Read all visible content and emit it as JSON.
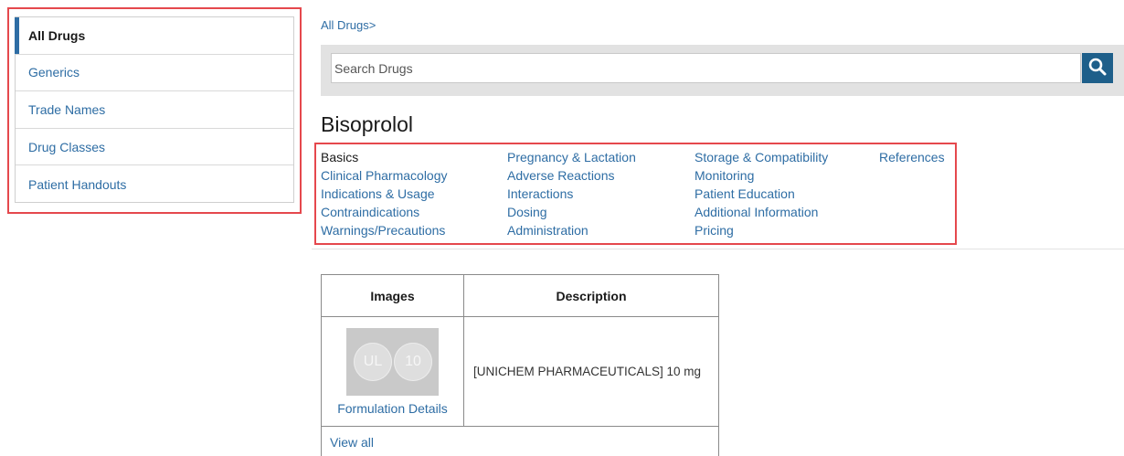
{
  "sidebar": {
    "items": [
      {
        "label": "All Drugs",
        "active": true
      },
      {
        "label": "Generics"
      },
      {
        "label": "Trade Names"
      },
      {
        "label": "Drug Classes"
      },
      {
        "label": "Patient Handouts"
      }
    ]
  },
  "breadcrumb": "All Drugs>",
  "search": {
    "placeholder": "Search Drugs",
    "icon": "search-icon"
  },
  "drug": {
    "title": "Bisoprolol"
  },
  "sections": {
    "col1": [
      "Basics",
      "Clinical Pharmacology",
      "Indications & Usage",
      "Contraindications",
      "Warnings/Precautions"
    ],
    "col2": [
      "Pregnancy & Lactation",
      "Adverse Reactions",
      "Interactions",
      "Dosing",
      "Administration"
    ],
    "col3": [
      "Storage & Compatibility",
      "Monitoring",
      "Patient Education",
      "Additional Information",
      "Pricing"
    ],
    "col4": [
      "References"
    ]
  },
  "table": {
    "headers": [
      "Images",
      "Description"
    ],
    "rows": [
      {
        "pill_imprint_left": "UL",
        "pill_imprint_right": "10",
        "link": "Formulation Details",
        "description": "[UNICHEM PHARMACEUTICALS] 10 mg"
      }
    ],
    "view_all": "View all"
  },
  "colors": {
    "accent": "#2e6da4",
    "search_button": "#1e5f8a",
    "highlight": "#e5484d"
  }
}
